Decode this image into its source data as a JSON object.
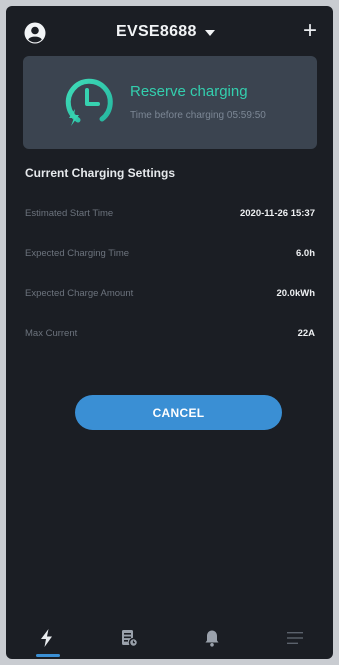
{
  "header": {
    "device_name": "EVSE8688",
    "add_symbol": "+"
  },
  "status": {
    "title": "Reserve charging",
    "subtitle": "Time before charging 05:59:50",
    "accent": "#33cfae"
  },
  "settings": {
    "title": "Current Charging Settings",
    "rows": [
      {
        "label": "Estimated Start Time",
        "value": "2020-11-26 15:37"
      },
      {
        "label": "Expected Charging Time",
        "value": "6.0h"
      },
      {
        "label": "Expected Charge Amount",
        "value": "20.0kWh"
      },
      {
        "label": "Max Current",
        "value": "22A"
      }
    ]
  },
  "actions": {
    "cancel_label": "CANCEL"
  },
  "nav": {
    "tabs": [
      {
        "icon": "lightning-icon",
        "active": true
      },
      {
        "icon": "document-icon",
        "active": false
      },
      {
        "icon": "bell-icon",
        "active": false
      },
      {
        "icon": "menu-icon",
        "active": false
      }
    ]
  },
  "colors": {
    "background": "#1b1e24",
    "card": "#3b4450",
    "primary": "#3a8fd4"
  }
}
